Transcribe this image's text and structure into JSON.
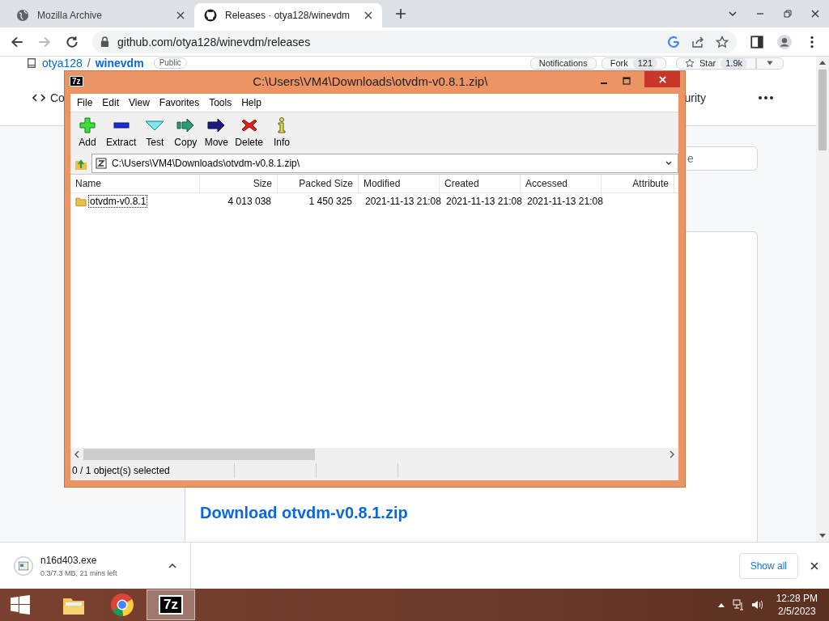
{
  "browser": {
    "tabs": [
      {
        "title": "Mozilla Archive",
        "selected": false
      },
      {
        "title": "Releases · otya128/winevdm",
        "selected": true
      }
    ],
    "url": "github.com/otya128/winevdm/releases"
  },
  "github": {
    "owner": "otya128",
    "separator": "/",
    "repo": "winevdm",
    "visibility": "Public",
    "notifications": "Notifications",
    "fork": "Fork",
    "fork_count": "121",
    "star": "Star",
    "star_count": "1.9k",
    "nav": [
      {
        "label": "Co",
        "kind": "code"
      },
      {
        "label": "urity",
        "kind": "plain"
      }
    ],
    "search_placeholder": "e",
    "download_link": "Download otvdm-v0.8.1.zip"
  },
  "archive_window": {
    "icon_text": "7z",
    "title": "C:\\Users\\VM4\\Downloads\\otvdm-v0.8.1.zip\\",
    "menu": [
      "File",
      "Edit",
      "View",
      "Favorites",
      "Tools",
      "Help"
    ],
    "toolbar": [
      {
        "label": "Add",
        "kind": "add"
      },
      {
        "label": "Extract",
        "kind": "extract"
      },
      {
        "label": "Test",
        "kind": "test"
      },
      {
        "label": "Copy",
        "kind": "copy"
      },
      {
        "label": "Move",
        "kind": "move"
      },
      {
        "label": "Delete",
        "kind": "delete"
      },
      {
        "label": "Info",
        "kind": "info"
      }
    ],
    "path": "C:\\Users\\VM4\\Downloads\\otvdm-v0.8.1.zip\\",
    "columns": [
      "Name",
      "Size",
      "Packed Size",
      "Modified",
      "Created",
      "Accessed",
      "Attribute"
    ],
    "rows": [
      {
        "cells": [
          "otvdm-v0.8.1",
          "4 013 038",
          "1 450 325",
          "2021-11-13 21:08",
          "2021-11-13 21:08",
          "2021-11-13 21:08"
        ],
        "focused": true
      }
    ],
    "status": "0 / 1 object(s) selected"
  },
  "download_bar": {
    "file": "n16d403.exe",
    "progress": "0.3/7.3 MB, 21 mins left",
    "show_all": "Show all"
  },
  "taskbar": {
    "apps": [
      {
        "kind": "explorer",
        "active": false
      },
      {
        "kind": "chrome",
        "active": false
      },
      {
        "kind": "sevenzip",
        "label": "7z",
        "active": true
      }
    ],
    "time": "12:28 PM",
    "date": "2/5/2023"
  }
}
